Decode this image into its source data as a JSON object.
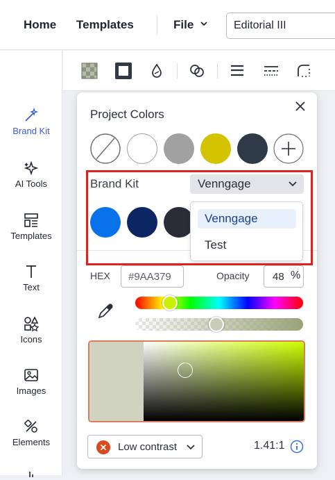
{
  "header": {
    "nav": [
      {
        "label": "Home"
      },
      {
        "label": "Templates"
      },
      {
        "label": "File"
      }
    ],
    "document_title": "Editorial III"
  },
  "sidebar": {
    "items": [
      {
        "label": "Brand Kit",
        "icon": "magic-wand-icon",
        "active": true
      },
      {
        "label": "AI Tools",
        "icon": "sparkles-icon"
      },
      {
        "label": "Templates",
        "icon": "templates-icon"
      },
      {
        "label": "Text",
        "icon": "text-icon"
      },
      {
        "label": "Icons",
        "icon": "shapes-icon"
      },
      {
        "label": "Images",
        "icon": "image-icon"
      },
      {
        "label": "Elements",
        "icon": "elements-icon"
      }
    ]
  },
  "toolbar": {
    "tools": [
      "transparency-icon",
      "border-icon",
      "color-drop-icon",
      "shapes-icon",
      "line-weight-icon",
      "line-style-icon",
      "corner-icon"
    ]
  },
  "color_panel": {
    "title": "Project Colors",
    "project_colors": [
      "none",
      "#ffffff",
      "#a1a1a1",
      "#d4c400",
      "#2e3a48"
    ],
    "brand_kit": {
      "label": "Brand Kit",
      "selected": "Venngage",
      "options": [
        "Venngage",
        "Test"
      ],
      "colors": [
        "#0a72e8",
        "#0b2663",
        "#2a2d37"
      ]
    },
    "hex_label": "HEX",
    "hex_value": "#9AA379",
    "opacity_label": "Opacity",
    "opacity_value": "48",
    "opacity_unit": "%",
    "current_color": "#9aa379",
    "contrast": {
      "label": "Low contrast",
      "ratio": "1.41:1"
    }
  }
}
